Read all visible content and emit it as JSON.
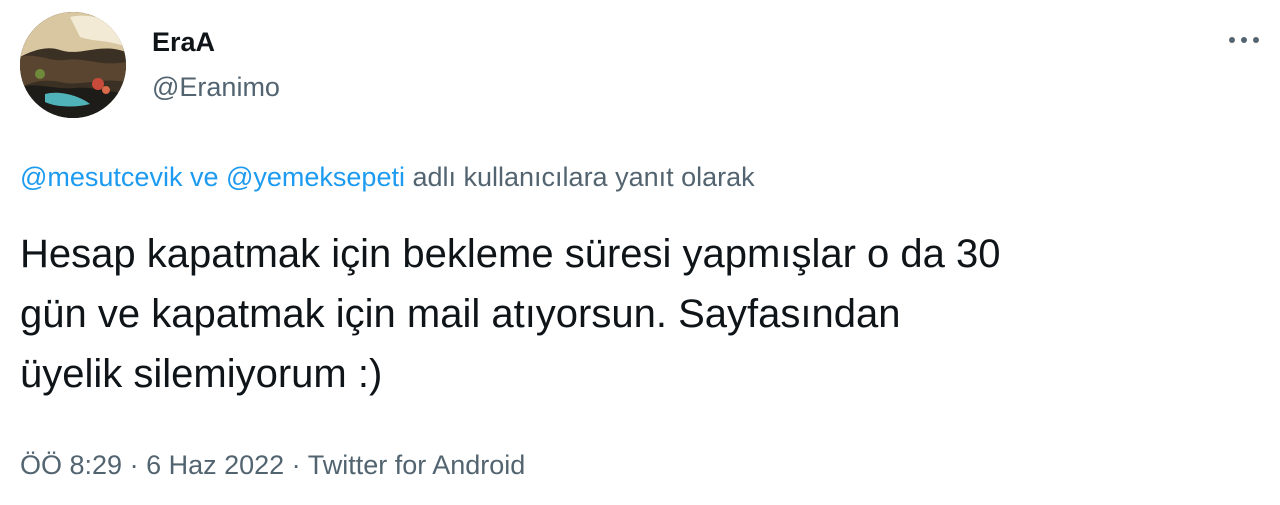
{
  "author": {
    "display_name": "EraA",
    "handle": "@Eranimo",
    "avatar_icon": "landscape-photo-avatar"
  },
  "menu": {
    "more_icon": "more-horizontal-icon"
  },
  "reply_context": {
    "mention_1": "@mesutcevik",
    "conjunction": " ve ",
    "mention_2": "@yemeksepeti",
    "suffix": " adlı kullanıcılara yanıt olarak"
  },
  "tweet": {
    "text": "Hesap kapatmak için bekleme süresi yapmışlar o da 30\ngün ve kapatmak için mail atıyorsun. Sayfasından\nüyelik silemiyorum :)"
  },
  "meta": {
    "time": "ÖÖ 8:29",
    "separator": " · ",
    "date": "6 Haz 2022",
    "source": "Twitter for Android"
  },
  "colors": {
    "text_primary": "#0f1419",
    "text_secondary": "#536471",
    "link": "#1d9bf0"
  }
}
